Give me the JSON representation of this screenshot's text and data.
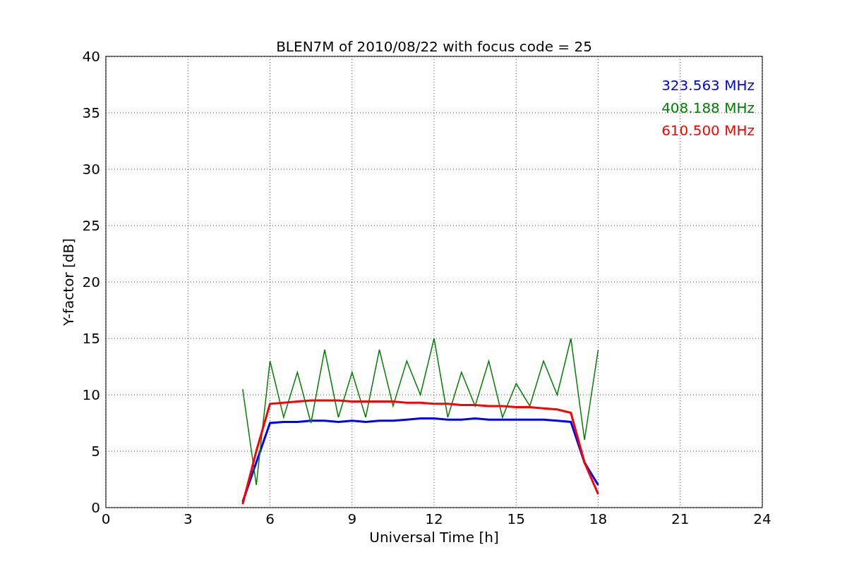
{
  "chart_data": {
    "type": "line",
    "title": "BLEN7M of 2010/08/22 with focus code = 25",
    "xlabel": "Universal Time [h]",
    "ylabel": "Y-factor [dB]",
    "x": [
      5,
      5.5,
      6,
      6.5,
      7,
      7.5,
      8,
      8.5,
      9,
      9.5,
      10,
      10.5,
      11,
      11.5,
      12,
      12.5,
      13,
      13.5,
      14,
      14.5,
      15,
      15.5,
      16,
      16.5,
      17,
      17.5,
      18
    ],
    "series": [
      {
        "name": "323.563 MHz",
        "color": "#0000ff",
        "values": [
          0.5,
          4,
          7.5,
          7.6,
          7.6,
          7.7,
          7.7,
          7.6,
          7.7,
          7.6,
          7.7,
          7.7,
          7.8,
          7.9,
          7.9,
          7.8,
          7.8,
          7.9,
          7.8,
          7.8,
          7.8,
          7.8,
          7.8,
          7.7,
          7.6,
          4,
          2
        ]
      },
      {
        "name": "408.188 MHz",
        "color": "#008000",
        "values": [
          10.5,
          2,
          13,
          8,
          12,
          7.5,
          14,
          8,
          12,
          8,
          14,
          9,
          13,
          10,
          15,
          8,
          12,
          9,
          13,
          8,
          11,
          9,
          13,
          10,
          15,
          6,
          14
        ]
      },
      {
        "name": "610.500 MHz",
        "color": "#ff0000",
        "values": [
          0.3,
          5,
          9.2,
          9.3,
          9.4,
          9.5,
          9.5,
          9.5,
          9.4,
          9.4,
          9.4,
          9.4,
          9.3,
          9.3,
          9.2,
          9.2,
          9.1,
          9.1,
          9.0,
          9.0,
          8.9,
          8.9,
          8.8,
          8.7,
          8.4,
          4,
          1.2
        ]
      }
    ],
    "xlim": [
      0,
      24
    ],
    "ylim": [
      0,
      40
    ],
    "xticks": [
      0,
      3,
      6,
      9,
      12,
      15,
      18,
      21,
      24
    ],
    "yticks": [
      0,
      5,
      10,
      15,
      20,
      25,
      30,
      35,
      40
    ],
    "grid": true
  }
}
